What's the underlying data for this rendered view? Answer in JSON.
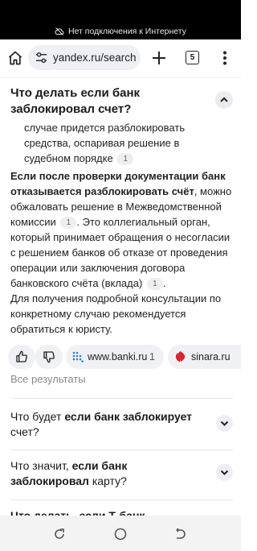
{
  "status": {
    "offline_text": "Нет подключения к Интернету"
  },
  "browser": {
    "url": "yandex.ru/search",
    "tab_count": "5"
  },
  "answer": {
    "question": "Что делать если банк заблокировал счет?",
    "fragment_text": "случае придется разблокировать средства, оспаривая решение в судебном порядке",
    "fragment_cite": "1",
    "p1_bold": "Если после проверки документации банк отказывается разблокировать счёт",
    "p1_a": ", можно обжаловать решение в Межведомственной комиссии",
    "p1_cite1": "1",
    "p1_b": ". Это коллегиальный орган, который принимает обращения о несогласии с решением банков об отказе от проведения операции или заключения договора банковского счёта (вклада)",
    "p1_cite2": "1",
    "p1_c": ".",
    "p2": "Для получения подробной консультации по конкретному случаю рекомендуется обратиться к юристу."
  },
  "sources": [
    {
      "name": "www.banki.ru",
      "count": "1"
    },
    {
      "name": "sinara.ru"
    }
  ],
  "all_results": "Все результаты",
  "related": [
    {
      "a": "Что будет ",
      "b": "если банк заблокирует",
      "c": " счет?"
    },
    {
      "a": "Что значит, ",
      "b": "если банк заблокировал",
      "c": " карту?"
    },
    {
      "a": "",
      "b": "Что делать, если Т-банк",
      "c": ""
    }
  ],
  "colors": {
    "sinara": "#d8242b",
    "banki": "#2f7de1"
  }
}
